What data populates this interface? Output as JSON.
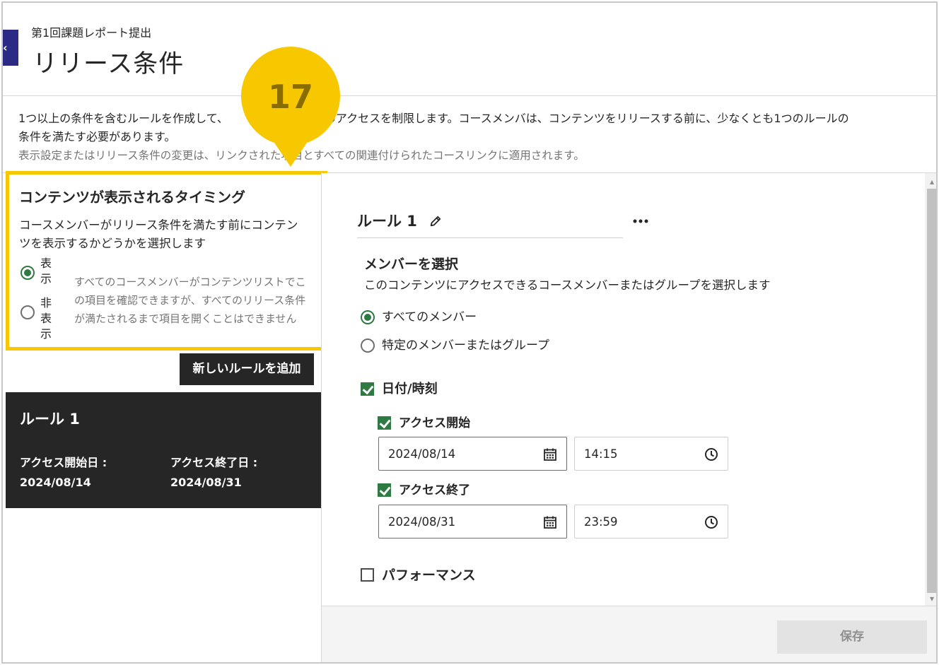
{
  "header": {
    "breadcrumb": "第1回課題レポート提出",
    "title": "リリース条件",
    "back_glyph": "‹"
  },
  "intro": {
    "line1": "1つ以上の条件を含むルールを作成して、　　　　　　　　へのアクセスを制限します。コースメンバは、コンテンツをリリースする前に、少なくとも1つのルールの",
    "line2": "条件を満たす必要があります。",
    "note": "表示設定またはリリース条件の変更は、リンクされた項目とすべての関連付けられたコースリンクに適用されます。"
  },
  "callout": {
    "number": "17"
  },
  "visibility": {
    "title": "コンテンツが表示されるタイミング",
    "description": "コースメンバーがリリース条件を満たす前にコンテンツを表示するかどうかを選択します",
    "options": [
      {
        "label": "表示",
        "selected": true
      },
      {
        "label": "非表示",
        "selected": false
      }
    ],
    "help": "すべてのコースメンバーがコンテンツリストでこの項目を確認できますが、すべてのリリース条件が満たされるまで項目を開くことはできません"
  },
  "add_rule_button": "新しいルールを追加",
  "rule_card": {
    "title": "ルール 1",
    "start_label": "アクセス開始日 :",
    "start_value": "2024/08/14",
    "end_label": "アクセス終了日 :",
    "end_value": "2024/08/31"
  },
  "rule_editor": {
    "name": "ルール 1",
    "members_title": "メンバーを選択",
    "members_desc": "このコンテンツにアクセスできるコースメンバーまたはグループを選択します",
    "member_options": [
      {
        "label": "すべてのメンバー",
        "selected": true
      },
      {
        "label": "特定のメンバーまたはグループ",
        "selected": false
      }
    ],
    "datetime": {
      "label": "日付/時刻",
      "checked": true,
      "start": {
        "label": "アクセス開始",
        "checked": true,
        "date": "2024/08/14",
        "time": "14:15"
      },
      "end": {
        "label": "アクセス終了",
        "checked": true,
        "date": "2024/08/31",
        "time": "23:59"
      }
    },
    "performance": {
      "label": "パフォーマンス",
      "checked": false
    }
  },
  "footer": {
    "save_label": "保存"
  },
  "colors": {
    "accent_green": "#2d7a43",
    "highlight_yellow": "#f7c800",
    "dark_card": "#262626",
    "back_tab": "#2b2a84"
  },
  "icons": [
    "pencil-icon",
    "more-icon",
    "calendar-icon",
    "clock-icon"
  ]
}
